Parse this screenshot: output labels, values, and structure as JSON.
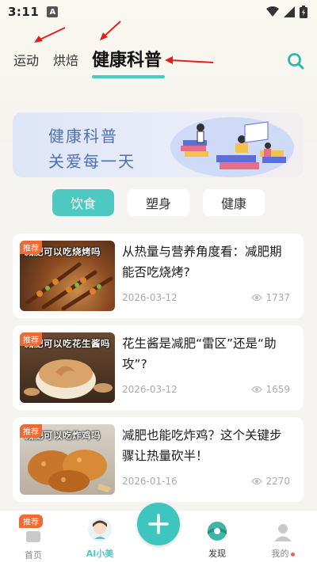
{
  "status_bar": {
    "time": "3:11",
    "badge": "A"
  },
  "top_tabs": [
    {
      "label": "运动"
    },
    {
      "label": "烘焙"
    },
    {
      "label": "健康科普"
    }
  ],
  "banner": {
    "line1": "健康科普",
    "line2": "关爱每一天"
  },
  "categories": [
    {
      "label": "饮食",
      "active": true
    },
    {
      "label": "塑身",
      "active": false
    },
    {
      "label": "健康",
      "active": false
    }
  ],
  "articles": [
    {
      "tag": "推荐",
      "thumb_caption": "减肥可以吃烧烤吗",
      "title": "从热量与营养角度看：减肥期能否吃烧烤?",
      "date": "2026-03-12",
      "views": "1737"
    },
    {
      "tag": "推荐",
      "thumb_caption": "减肥可以吃花生酱吗",
      "title": "花生酱是减肥“雷区”还是“助攻”?",
      "date": "2026-03-12",
      "views": "1659"
    },
    {
      "tag": "推荐",
      "thumb_caption": "减肥可以吃炸鸡吗",
      "title": "减肥也能吃炸鸡？这个关键步骤让热量砍半！",
      "date": "2026-01-16",
      "views": "2270"
    }
  ],
  "bottom_nav": {
    "home": "首页",
    "home_tag": "推荐",
    "ai": "AI小美",
    "discover": "发现",
    "mine": "我的"
  },
  "colors": {
    "accent": "#4ec9c2",
    "tag": "#f06a33",
    "arrow": "#e02020"
  }
}
